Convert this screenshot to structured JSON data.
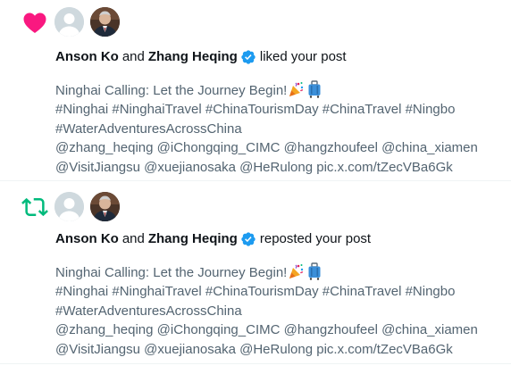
{
  "notifications": [
    {
      "type": "like",
      "type_icon": "heart-icon",
      "icon_color": "#f91880",
      "actor_1": "Anson Ko",
      "connector": "and",
      "actor_2": "Zhang Heqing",
      "action": "liked your post",
      "post_lines": [
        "Ninghai Calling: Let the Journey Begin!",
        "#Ninghai #NinghaiTravel #ChinaTourismDay #ChinaTravel #Ningbo",
        "#WaterAdventuresAcrossChina",
        "@zhang_heqing @iChongqing_CIMC @hangzhoufeel @china_xiamen",
        "@VisitJiangsu @xuejianosaka @HeRulong pic.x.com/tZecVBa6Gk"
      ]
    },
    {
      "type": "repost",
      "type_icon": "repost-icon",
      "icon_color": "#00ba7c",
      "actor_1": "Anson Ko",
      "connector": "and",
      "actor_2": "Zhang Heqing",
      "action": "reposted your post",
      "post_lines": [
        "Ninghai Calling: Let the Journey Begin!",
        "#Ninghai #NinghaiTravel #ChinaTourismDay #ChinaTravel #Ningbo",
        "#WaterAdventuresAcrossChina",
        "@zhang_heqing @iChongqing_CIMC @hangzhoufeel @china_xiamen",
        "@VisitJiangsu @xuejianosaka @HeRulong pic.x.com/tZecVBa6Gk"
      ]
    }
  ],
  "verified_color": "#1d9bf0",
  "emojis": [
    "party-popper-icon",
    "suitcase-icon"
  ]
}
